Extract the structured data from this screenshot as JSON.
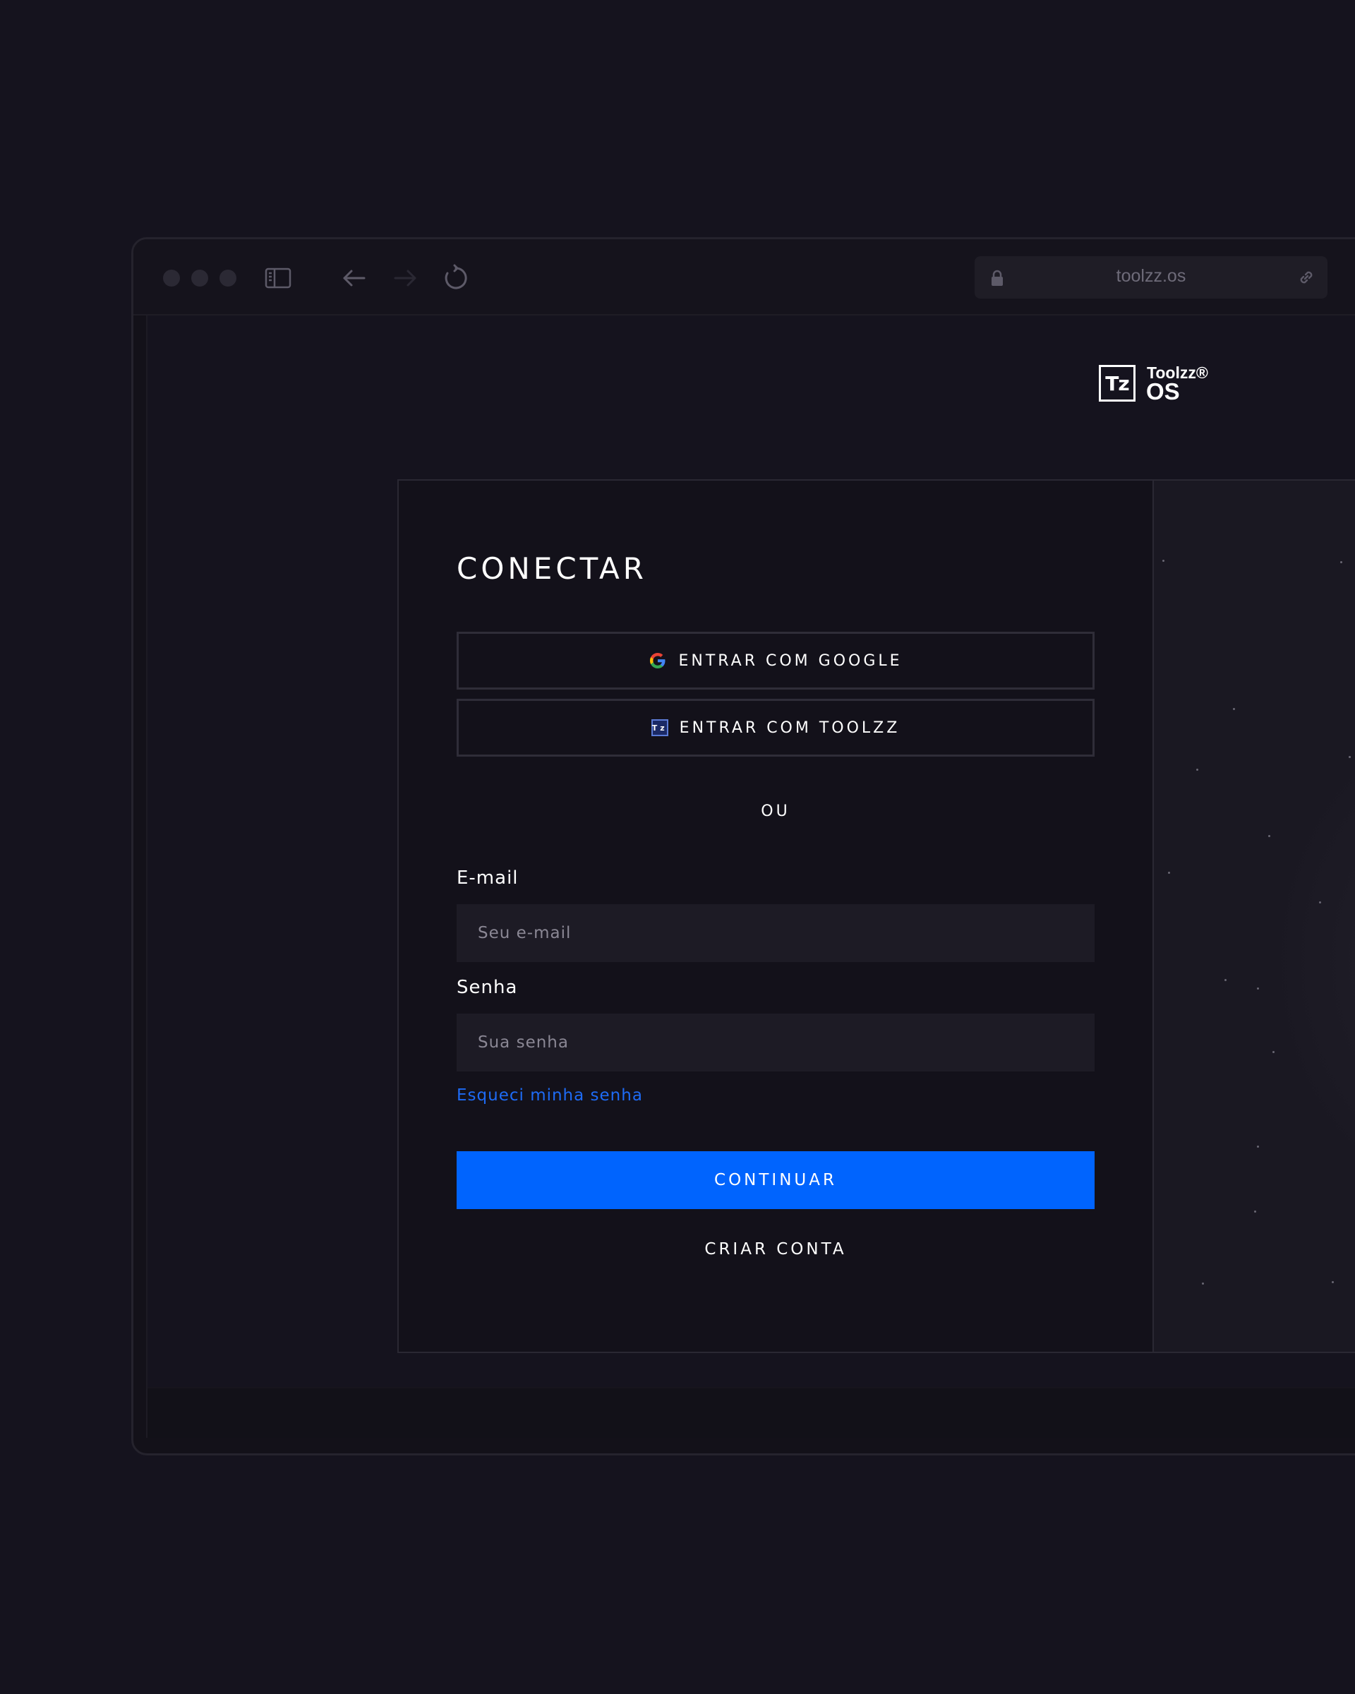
{
  "browser": {
    "url": "toolzz.os"
  },
  "logo": {
    "mark": "Tz",
    "name_top": "Toolzz®",
    "name_bottom": "OS"
  },
  "login": {
    "title": "CONECTAR",
    "google_button": "ENTRAR COM GOOGLE",
    "toolzz_button": "ENTRAR COM TOOLZZ",
    "toolzz_icon_text": "Tz",
    "divider": "OU",
    "email_label": "E-mail",
    "email_placeholder": "Seu e-mail",
    "password_label": "Senha",
    "password_placeholder": "Sua senha",
    "forgot_link": "Esqueci minha senha",
    "continue_button": "CONTINUAR",
    "create_account": "CRIAR CONTA"
  },
  "colors": {
    "background": "#15131e",
    "primary": "#0064fe",
    "link": "#1e6bf5",
    "input_bg": "#1d1b25"
  }
}
